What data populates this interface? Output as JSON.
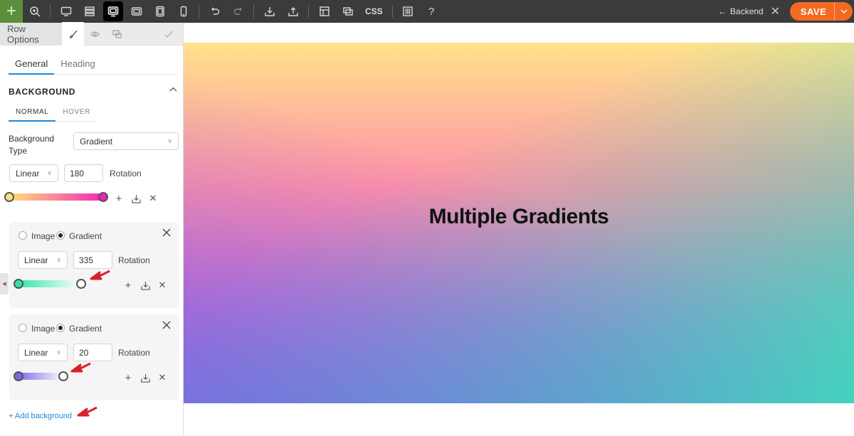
{
  "toolbar": {
    "css_label": "CSS",
    "backend_label": "Backend",
    "save_label": "SAVE"
  },
  "panel": {
    "title": "Row Options",
    "sub_tabs": [
      "General",
      "Heading"
    ],
    "section_title": "BACKGROUND",
    "state_tabs": [
      "NORMAL",
      "HOVER"
    ],
    "background_type_label": "Background Type",
    "background_type_value": "Gradient",
    "main_gradient": {
      "type": "Linear",
      "rotation": "180",
      "rotation_label": "Rotation",
      "color_start": "#ffe27a",
      "color_end": "#f01fb7"
    },
    "layers": [
      {
        "option_image": "Image",
        "option_gradient": "Gradient",
        "selected": "Gradient",
        "type": "Linear",
        "rotation": "335",
        "rotation_label": "Rotation",
        "color_start": "#2fe3a9",
        "color_end": "#ffffff"
      },
      {
        "option_image": "Image",
        "option_gradient": "Gradient",
        "selected": "Gradient",
        "type": "Linear",
        "rotation": "20",
        "rotation_label": "Rotation",
        "color_start": "#7b66e3",
        "color_end": "#ffffff"
      }
    ],
    "add_background": "+ Add background"
  },
  "canvas": {
    "heading": "Multiple Gradients"
  },
  "colors": {
    "toolbar_bg": "#3b3b3b",
    "save": "#f26a21",
    "accent_blue": "#1c8ad8",
    "annotation_arrow": "#d9202a"
  }
}
